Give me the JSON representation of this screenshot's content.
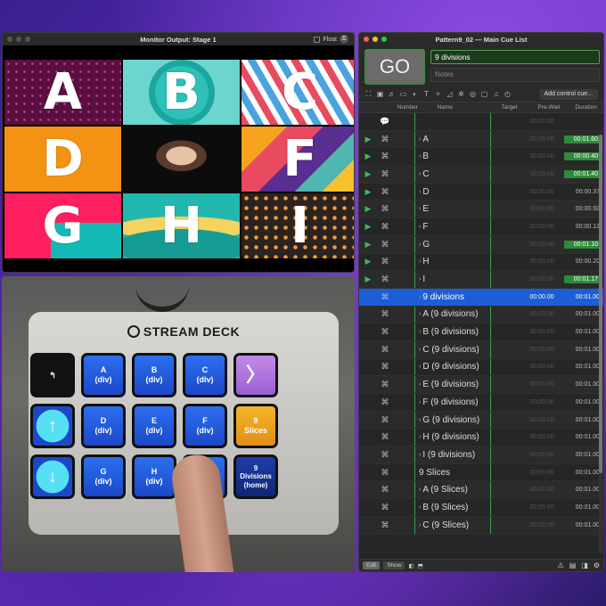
{
  "monitor": {
    "title": "Monitor Output: Stage 1",
    "float_label": "Float",
    "tiles": [
      "A",
      "B",
      "C",
      "D",
      "",
      "F",
      "G",
      "H",
      "I"
    ]
  },
  "deck": {
    "brand": "STREAM DECK",
    "keys": [
      {
        "label": "↰",
        "style": "dark"
      },
      {
        "label": "A\n(div)",
        "style": "blue"
      },
      {
        "label": "B\n(div)",
        "style": "blue"
      },
      {
        "label": "C\n(div)",
        "style": "blue"
      },
      {
        "label": "〉",
        "style": "purple"
      },
      {
        "label": "↑",
        "style": "cyan"
      },
      {
        "label": "D\n(div)",
        "style": "blue"
      },
      {
        "label": "E\n(div)",
        "style": "blue"
      },
      {
        "label": "F\n(div)",
        "style": "blue"
      },
      {
        "label": "9\nSlices",
        "style": "orange"
      },
      {
        "label": "↓",
        "style": "cyan"
      },
      {
        "label": "G\n(div)",
        "style": "blue"
      },
      {
        "label": "H\n(div)",
        "style": "blue"
      },
      {
        "label": "",
        "style": "blue"
      },
      {
        "label": "9\nDivisions\n(home)",
        "style": "navy"
      }
    ]
  },
  "cuelist": {
    "title": "Pattern9_02 — Main Cue List",
    "go_label": "GO",
    "cue_name": "9 divisions",
    "notes_placeholder": "Notes",
    "add_control_label": "Add control cue...",
    "columns": {
      "number": "Number",
      "name": "Name",
      "target": "Target",
      "prewait": "Pre-Wait",
      "duration": "Duration"
    },
    "rows": [
      {
        "name": "",
        "prewait": "00:00.00",
        "duration": "",
        "icon": "💬",
        "play": false,
        "group": false,
        "dur_bar": false,
        "selected": false
      },
      {
        "name": "A",
        "prewait": "00:00.00",
        "duration": "00:01.60",
        "icon": "⌘",
        "play": true,
        "group": true,
        "dur_bar": true,
        "selected": false
      },
      {
        "name": "B",
        "prewait": "00:00.00",
        "duration": "00:00.40",
        "icon": "⌘",
        "play": true,
        "group": true,
        "dur_bar": true,
        "selected": false
      },
      {
        "name": "C",
        "prewait": "00:00.00",
        "duration": "00:01.40",
        "icon": "⌘",
        "play": true,
        "group": true,
        "dur_bar": true,
        "selected": false
      },
      {
        "name": "D",
        "prewait": "00:00.00",
        "duration": "00:00.37",
        "icon": "⌘",
        "play": true,
        "group": true,
        "dur_bar": false,
        "selected": false
      },
      {
        "name": "E",
        "prewait": "00:00.00",
        "duration": "00:00.92",
        "icon": "⌘",
        "play": true,
        "group": true,
        "dur_bar": false,
        "selected": false
      },
      {
        "name": "F",
        "prewait": "00:00.00",
        "duration": "00:00.13",
        "icon": "⌘",
        "play": true,
        "group": true,
        "dur_bar": false,
        "selected": false
      },
      {
        "name": "G",
        "prewait": "00:00.00",
        "duration": "00:01.10",
        "icon": "⌘",
        "play": true,
        "group": true,
        "dur_bar": true,
        "selected": false
      },
      {
        "name": "H",
        "prewait": "00:00.00",
        "duration": "00:00.20",
        "icon": "⌘",
        "play": true,
        "group": true,
        "dur_bar": false,
        "selected": false
      },
      {
        "name": "I",
        "prewait": "00:00.00",
        "duration": "00:01.17",
        "icon": "⌘",
        "play": true,
        "group": true,
        "dur_bar": true,
        "selected": false
      },
      {
        "name": "9 divisions",
        "prewait": "00:00.00",
        "duration": "00:01.00",
        "icon": "⌘",
        "play": false,
        "group": true,
        "dur_bar": false,
        "selected": true
      },
      {
        "name": "A (9 divisions)",
        "prewait": "00:00.00",
        "duration": "00:01.00",
        "icon": "⌘",
        "play": false,
        "group": true,
        "dur_bar": false,
        "selected": false
      },
      {
        "name": "B (9 divisions)",
        "prewait": "00:00.00",
        "duration": "00:01.00",
        "icon": "⌘",
        "play": false,
        "group": true,
        "dur_bar": false,
        "selected": false
      },
      {
        "name": "C (9 divisions)",
        "prewait": "00:00.00",
        "duration": "00:01.00",
        "icon": "⌘",
        "play": false,
        "group": true,
        "dur_bar": false,
        "selected": false
      },
      {
        "name": "D (9 divisions)",
        "prewait": "00:00.00",
        "duration": "00:01.00",
        "icon": "⌘",
        "play": false,
        "group": true,
        "dur_bar": false,
        "selected": false
      },
      {
        "name": "E (9 divisions)",
        "prewait": "00:00.00",
        "duration": "00:01.00",
        "icon": "⌘",
        "play": false,
        "group": true,
        "dur_bar": false,
        "selected": false
      },
      {
        "name": "F (9 divisions)",
        "prewait": "00:00.00",
        "duration": "00:01.00",
        "icon": "⌘",
        "play": false,
        "group": true,
        "dur_bar": false,
        "selected": false
      },
      {
        "name": "G (9 divisions)",
        "prewait": "00:00.00",
        "duration": "00:01.00",
        "icon": "⌘",
        "play": false,
        "group": true,
        "dur_bar": false,
        "selected": false
      },
      {
        "name": "H (9 divisions)",
        "prewait": "00:00.00",
        "duration": "00:01.00",
        "icon": "⌘",
        "play": false,
        "group": true,
        "dur_bar": false,
        "selected": false
      },
      {
        "name": "I (9 divisions)",
        "prewait": "00:00.00",
        "duration": "00:01.00",
        "icon": "⌘",
        "play": false,
        "group": true,
        "dur_bar": false,
        "selected": false
      },
      {
        "name": "9 Slices",
        "prewait": "00:00.00",
        "duration": "00:01.00",
        "icon": "⌘",
        "play": false,
        "group": false,
        "dur_bar": false,
        "selected": false
      },
      {
        "name": "A (9 Slices)",
        "prewait": "00:00.00",
        "duration": "00:01.00",
        "icon": "⌘",
        "play": false,
        "group": true,
        "dur_bar": false,
        "selected": false
      },
      {
        "name": "B (9 Slices)",
        "prewait": "00:00.00",
        "duration": "00:01.00",
        "icon": "⌘",
        "play": false,
        "group": true,
        "dur_bar": false,
        "selected": false
      },
      {
        "name": "C (9 Slices)",
        "prewait": "00:00.00",
        "duration": "00:01.00",
        "icon": "⌘",
        "play": false,
        "group": true,
        "dur_bar": false,
        "selected": false
      }
    ],
    "footer": {
      "edit_label": "Edit",
      "show_label": "Show"
    }
  }
}
